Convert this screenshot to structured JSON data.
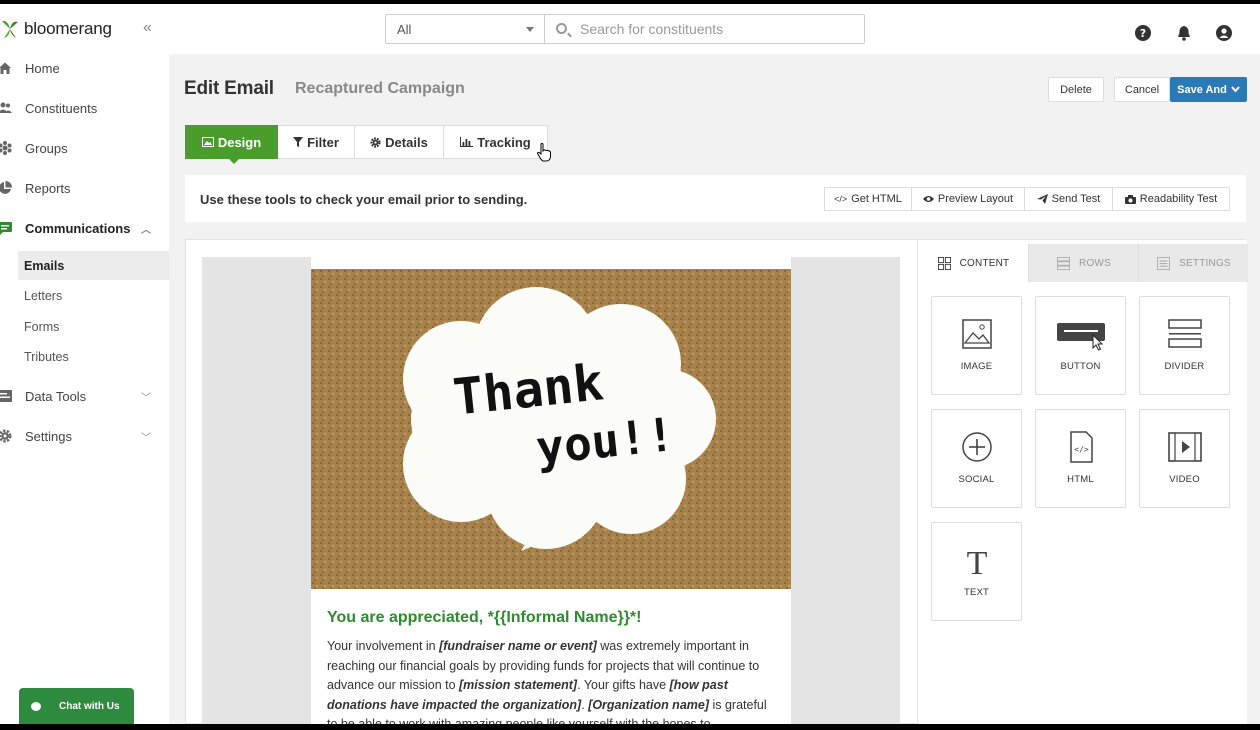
{
  "brand": {
    "name": "bloomerang",
    "accent": "#4a9d2c",
    "primary": "#2a7ab8"
  },
  "sidebar": {
    "collapse_icon": "double-chevron-left-icon",
    "items": [
      {
        "label": "Home",
        "icon": "home-icon"
      },
      {
        "label": "Constituents",
        "icon": "people-icon"
      },
      {
        "label": "Groups",
        "icon": "groups-icon"
      },
      {
        "label": "Reports",
        "icon": "pie-chart-icon"
      },
      {
        "label": "Communications",
        "icon": "chat-icon"
      },
      {
        "label": "Data Tools",
        "icon": "database-icon"
      },
      {
        "label": "Settings",
        "icon": "gear-icon"
      }
    ],
    "communications_sub": [
      "Emails",
      "Letters",
      "Forms",
      "Tributes"
    ],
    "chat_label": "Chat with Us"
  },
  "topbar": {
    "scope_value": "All",
    "search_placeholder": "Search for constituents",
    "icons": [
      "help-icon",
      "bell-icon",
      "user-icon"
    ]
  },
  "header": {
    "title": "Edit Email",
    "campaign": "Recaptured Campaign",
    "delete_label": "Delete",
    "cancel_label": "Cancel",
    "save_label": "Save And"
  },
  "tabs": [
    {
      "label": "Design",
      "icon": "image-icon"
    },
    {
      "label": "Filter",
      "icon": "filter-icon"
    },
    {
      "label": "Details",
      "icon": "gear-icon"
    },
    {
      "label": "Tracking",
      "icon": "bar-chart-icon"
    }
  ],
  "toolbar": {
    "text": "Use these tools to check your email prior to sending.",
    "buttons": [
      {
        "label": "Get HTML",
        "icon": "code-icon"
      },
      {
        "label": "Preview Layout",
        "icon": "eye-icon"
      },
      {
        "label": "Send Test",
        "icon": "paper-plane-icon"
      },
      {
        "label": "Readability Test",
        "icon": "camera-icon"
      }
    ]
  },
  "email": {
    "hero_line1": "Thank",
    "hero_line2": "you!!",
    "heading": "You are appreciated, *{{Informal Name}}*!",
    "body": {
      "p1": "Your involvement in ",
      "b1": "[fundraiser name or event]",
      "p2": " was extremely important in reaching our financial goals by providing funds for projects that will continue to advance our mission to ",
      "b2": "[mission statement]",
      "p3": ". Your gifts have ",
      "b3": "[how past donations have impacted the organization]",
      "p4": ". ",
      "b4": "[Organization name]",
      "p5": " is grateful to be able to work with amazing people like yourself with the hopes to"
    }
  },
  "panel": {
    "tabs": [
      "CONTENT",
      "ROWS",
      "SETTINGS"
    ],
    "blocks": [
      "IMAGE",
      "BUTTON",
      "DIVIDER",
      "SOCIAL",
      "HTML",
      "VIDEO",
      "TEXT"
    ]
  }
}
